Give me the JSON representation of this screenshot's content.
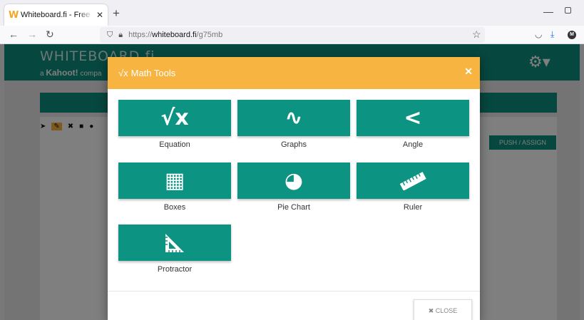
{
  "browser": {
    "tab_title": "Whiteboard.fi - Free online whi",
    "tab_favicon": "W",
    "tab_close": "✕",
    "new_tab": "+",
    "url_prefix": "https://",
    "url_domain": "whiteboard.fi",
    "url_path": "/g75mb",
    "avatar_letter": "M"
  },
  "app": {
    "logo_text": "WHITEBOARD.fi",
    "logo_sub_prefix": "a",
    "logo_sub_brand": "Kahoot!",
    "logo_sub_suffix": "compa",
    "push_button": "PUSH / ASSIGN"
  },
  "modal": {
    "title_icon": "√x",
    "title": "Math Tools",
    "close_x": "✕",
    "tools": [
      {
        "label": "Equation",
        "glyph": "√x",
        "icon": "equation-icon"
      },
      {
        "label": "Graphs",
        "glyph": "∿",
        "icon": "graph-icon"
      },
      {
        "label": "Angle",
        "glyph": "<",
        "icon": "angle-icon"
      },
      {
        "label": "Boxes",
        "glyph": "▦",
        "icon": "boxes-icon"
      },
      {
        "label": "Pie Chart",
        "glyph": "◕",
        "icon": "pie-chart-icon"
      },
      {
        "label": "Ruler",
        "glyph": "📏",
        "icon": "ruler-icon"
      },
      {
        "label": "Protractor",
        "glyph": "◺",
        "icon": "protractor-icon"
      }
    ],
    "close_button": "✖ CLOSE"
  },
  "colors": {
    "header_teal": "#0c8f7e",
    "tool_teal": "#0c9382",
    "modal_header": "#f8b441"
  }
}
